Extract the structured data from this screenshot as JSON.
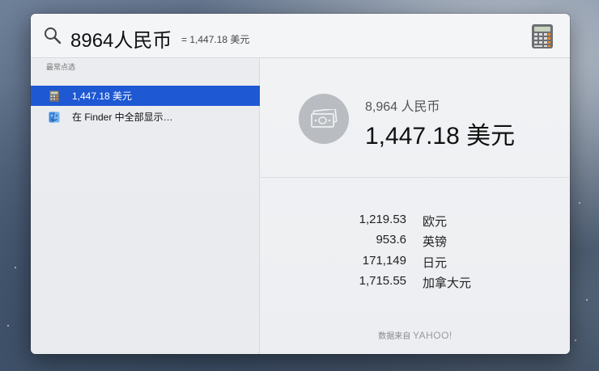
{
  "search": {
    "query": "8964人民币",
    "inline_result": "= 1,447.18 美元",
    "app_icon": "calculator-icon"
  },
  "results": {
    "section_title": "最常点选",
    "items": [
      {
        "label": "1,447.18 美元",
        "icon": "calculator-icon",
        "selected": true
      },
      {
        "label": "在 Finder 中全部显示…",
        "icon": "finder-icon",
        "selected": false
      }
    ]
  },
  "preview": {
    "icon": "money-icon",
    "from_amount": "8,964 人民币",
    "to_amount": "1,447.18 美元",
    "conversions": [
      {
        "value": "1,219.53",
        "currency": "欧元"
      },
      {
        "value": "953.6",
        "currency": "英镑"
      },
      {
        "value": "171,149",
        "currency": "日元"
      },
      {
        "value": "1,715.55",
        "currency": "加拿大元"
      }
    ],
    "source_prefix": "数据来自",
    "source_brand": "YAHOO!"
  },
  "colors": {
    "selection": "#1e58d3",
    "panel_bg": "#eceef1"
  }
}
